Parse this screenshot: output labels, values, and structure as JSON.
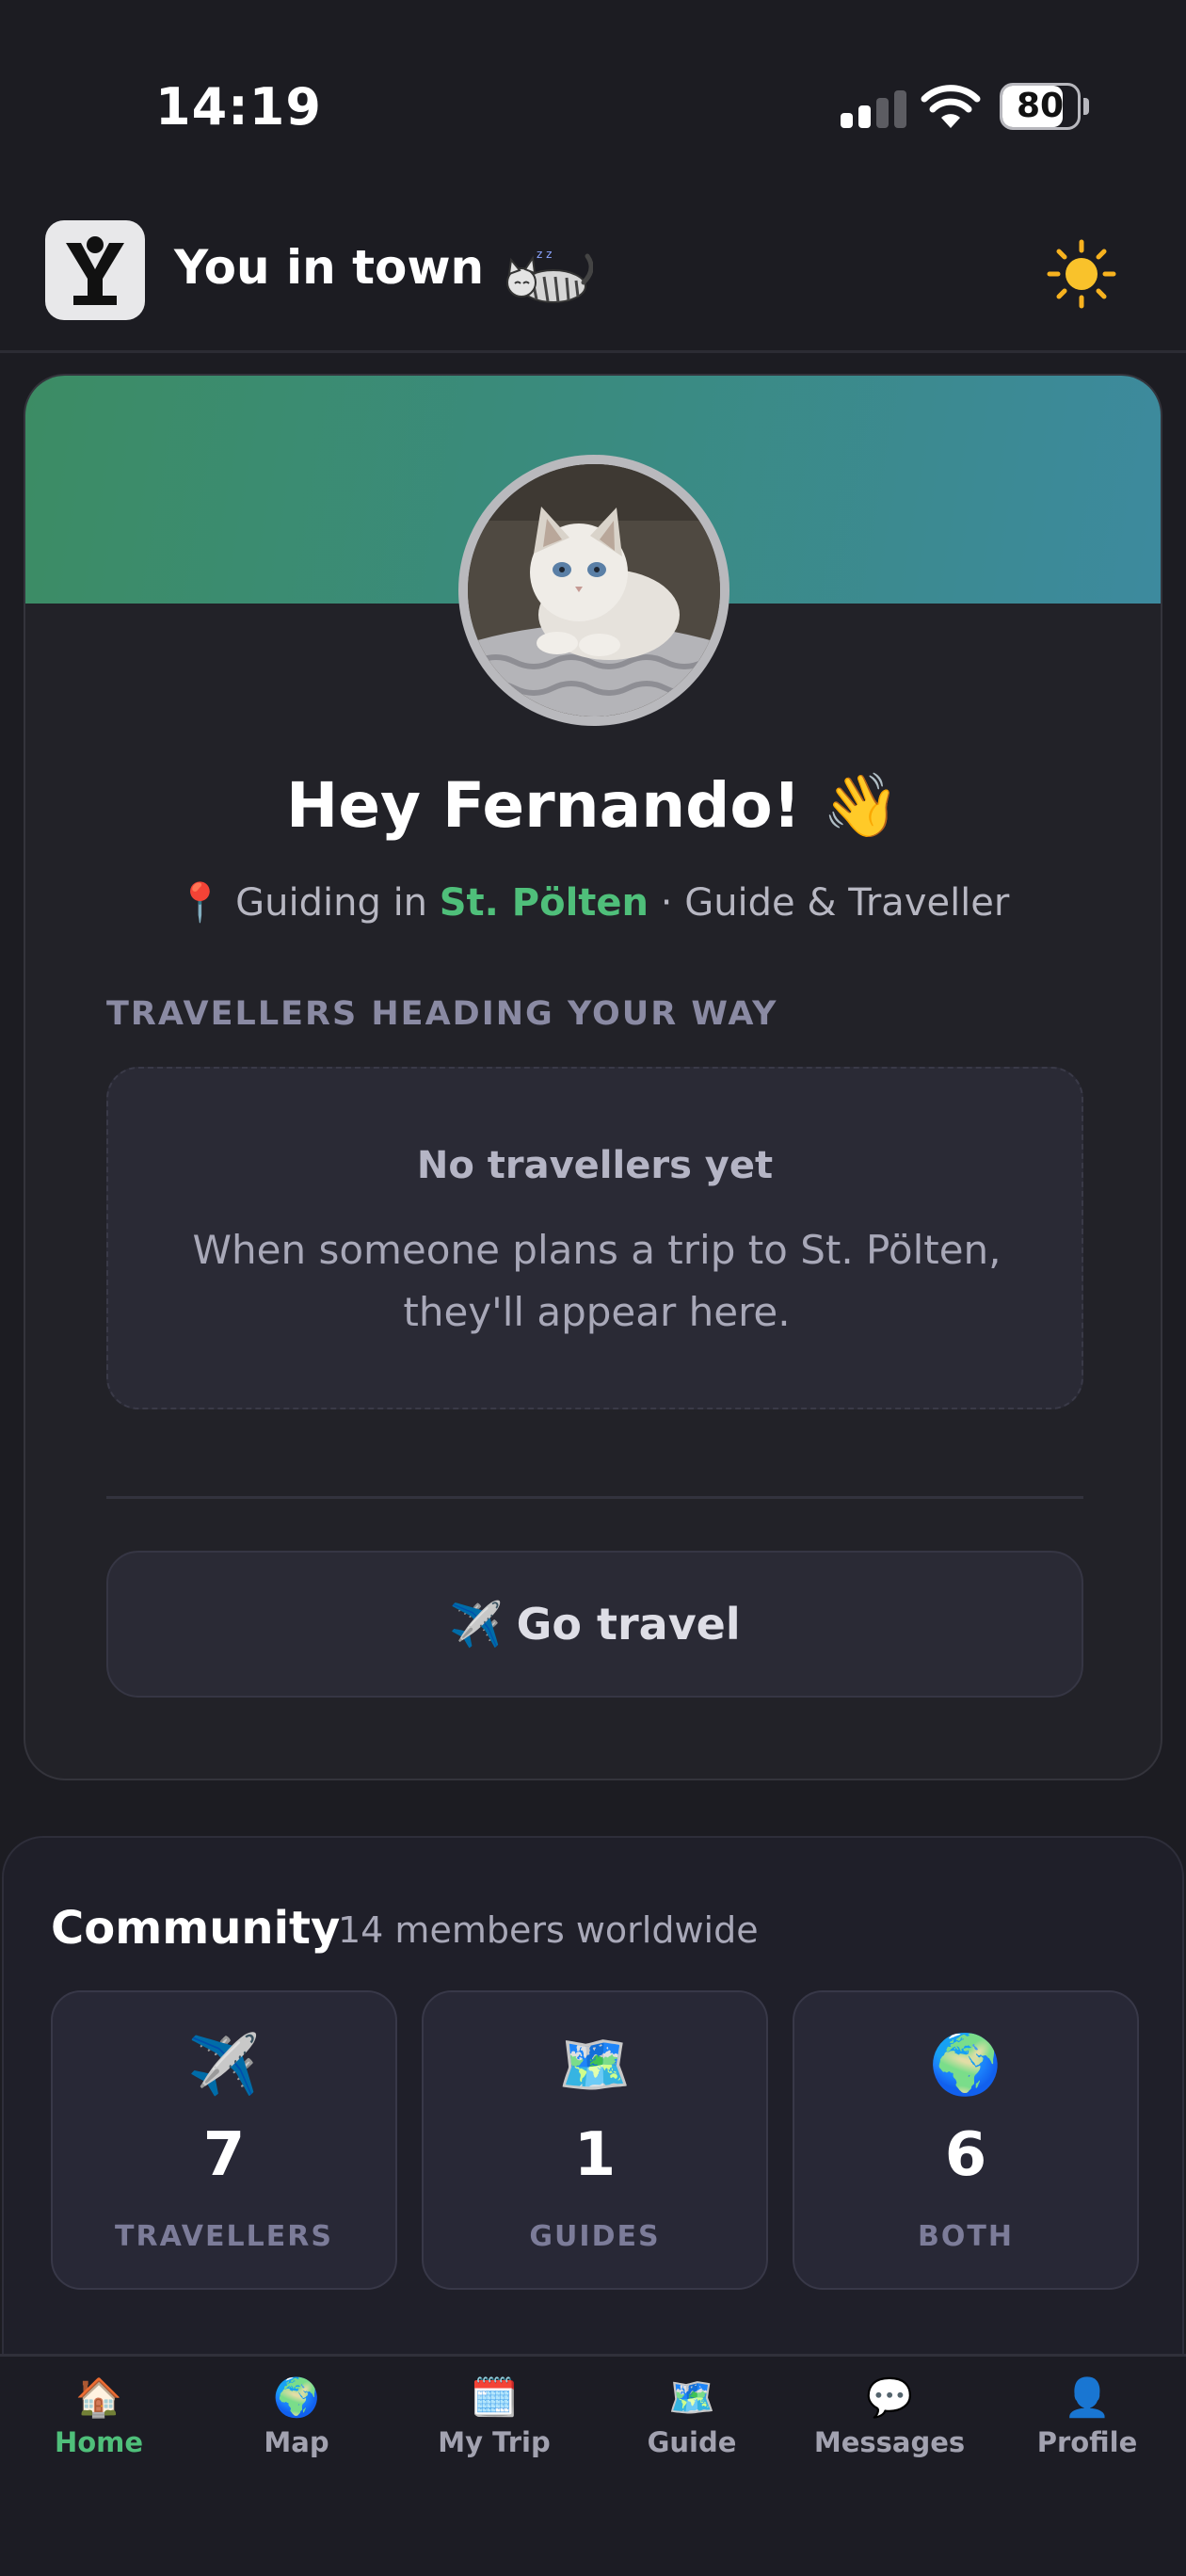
{
  "status_bar": {
    "time": "14:19",
    "battery": "80",
    "battery_percent": 80
  },
  "header": {
    "app_title": "You in town",
    "logo_letter": "Y",
    "theme_icon": "sun-icon"
  },
  "profile": {
    "greeting": "Hey Fernando! 👋",
    "location_prefix": "📍 Guiding in ",
    "city": "St. Pölten",
    "role_suffix": " · Guide & Traveller",
    "section_label": "TRAVELLERS HEADING YOUR WAY",
    "empty_title": "No travellers yet",
    "empty_text": "When someone plans a trip to St. Pölten, they'll appear here.",
    "go_travel_icon": "✈️",
    "go_travel_label": "Go travel"
  },
  "community": {
    "title": "Community",
    "subtitle": "14 members worldwide",
    "stats": [
      {
        "icon": "✈️",
        "value": "7",
        "label": "TRAVELLERS"
      },
      {
        "icon": "🗺️",
        "value": "1",
        "label": "GUIDES"
      },
      {
        "icon": "🌍",
        "value": "6",
        "label": "BOTH"
      }
    ]
  },
  "tabs": [
    {
      "icon": "🏠",
      "label": "Home",
      "active": true
    },
    {
      "icon": "🌍",
      "label": "Map"
    },
    {
      "icon": "🗓️",
      "label": "My Trip"
    },
    {
      "icon": "🗺️",
      "label": "Guide"
    },
    {
      "icon": "💬",
      "label": "Messages"
    },
    {
      "icon": "👤",
      "label": "Profile"
    }
  ],
  "colors": {
    "accent": "#4fbf7a",
    "background": "#1c1c22",
    "card": "#222228",
    "banner_start": "#3c8c64",
    "banner_end": "#3d8a9e"
  }
}
